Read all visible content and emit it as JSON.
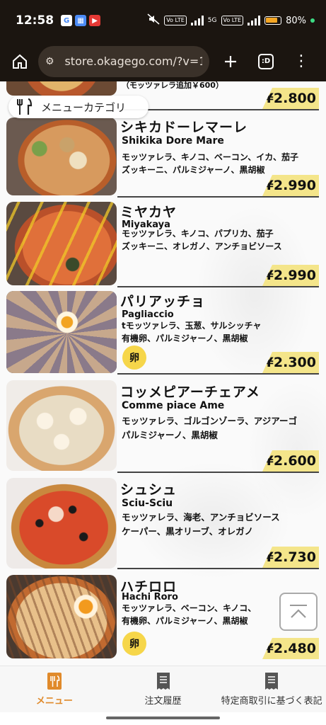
{
  "status": {
    "time": "12:58",
    "battery": "80%",
    "net_label": "5G"
  },
  "browser": {
    "url": "store.okagego.com/?v=1",
    "tabs_label": ":D"
  },
  "category_button": "メニューカテゴリ",
  "top_partial": {
    "desc_tail": "（モッツァレラ追加￥600）",
    "price": "¥2.800"
  },
  "items": [
    {
      "name_ja": "シキカドーレマーレ",
      "name_en": "Shikika Dore Mare",
      "desc": "モッツァレラ、キノコ、ベーコン、イカ、茄子\nズッキーニ、パルミジャーノ、黒胡椒",
      "price": "¥2.990",
      "egg": null
    },
    {
      "name_ja": "ミヤカヤ",
      "name_en": "Miyakaya",
      "desc": "モッツァレラ、キノコ、パプリカ、茄子\nズッキーニ、オレガノ、アンチョビソース",
      "price": "¥2.990",
      "egg": null
    },
    {
      "name_ja": "パリアッチョ",
      "name_en": "Pagliaccio",
      "desc": "tモッツァレラ、玉葱、サルシッチャ\n有機卵、パルミジャーノ、黒胡椒",
      "price": "¥2.300",
      "egg": "卵"
    },
    {
      "name_ja": "コッメピアーチェアメ",
      "name_en": "Comme piace Ame",
      "desc": "モッツァレラ、ゴルゴンゾーラ、アジアーゴ\nパルミジャーノ、黒胡椒",
      "price": "¥2.600",
      "egg": null
    },
    {
      "name_ja": "シュシュ",
      "name_en": "Sciu-Sciu",
      "desc": "モッツァレラ、海老、アンチョビソース\nケーパー、黒オリーブ、オレガノ",
      "price": "¥2.730",
      "egg": null
    },
    {
      "name_ja": "ハチロロ",
      "name_en": "Hachi Roro",
      "desc": "モッツァレラ、ベーコン、キノコ、\n有機卵、パルミジャーノ、黒胡椒",
      "price": "¥2.480",
      "egg": "卵"
    }
  ],
  "nav": {
    "menu": "メニュー",
    "history": "注文履歴",
    "legal": "特定商取引に基づく表記"
  },
  "colors": {
    "accent": "#e08a2b",
    "price_bg": "#f4e58a",
    "egg_bg": "#f6d64a",
    "topbar": "#1b1510"
  }
}
